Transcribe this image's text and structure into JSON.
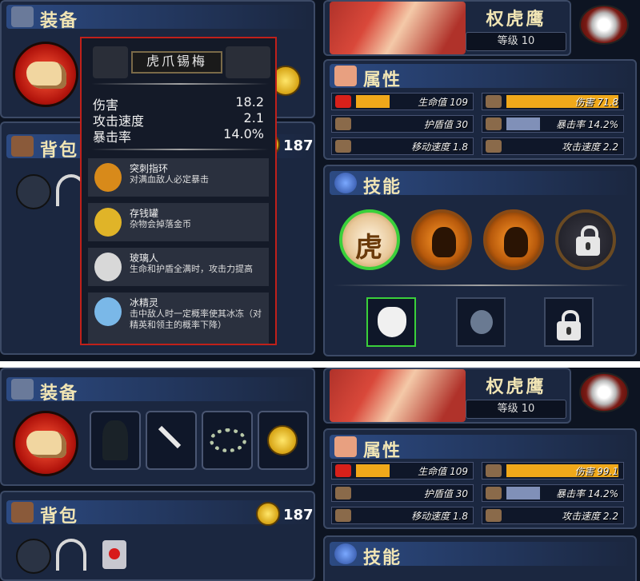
{
  "equipment": {
    "title": "装备"
  },
  "backpack": {
    "title": "背包",
    "gold": "187"
  },
  "character": {
    "name": "权虎鹰",
    "level": "等级 10"
  },
  "attributes": {
    "title": "属性",
    "stats_top": [
      {
        "label": "生命值 109",
        "fraction": 0.3,
        "color": "#f0a81a",
        "icon": "heart-icon"
      },
      {
        "label": "伤害 71.8",
        "fraction": 1.0,
        "color": "#f0a81a",
        "icon": "sword-icon"
      },
      {
        "label": "护盾值 30",
        "fraction": 0.0,
        "color": "#8090b8",
        "icon": "shield-icon"
      },
      {
        "label": "暴击率 14.2%",
        "fraction": 0.3,
        "color": "#8090b8",
        "icon": "eye-icon"
      },
      {
        "label": "移动速度 1.8",
        "fraction": 0.0,
        "color": "#8090b8",
        "icon": "boot-icon"
      },
      {
        "label": "攻击速度 2.2",
        "fraction": 0.0,
        "color": "#8090b8",
        "icon": "fist-icon"
      }
    ],
    "stats_bottom": [
      {
        "label": "生命值 109",
        "fraction": 0.3,
        "color": "#f0a81a",
        "icon": "heart-icon"
      },
      {
        "label": "伤害 99.1",
        "fraction": 1.0,
        "color": "#f0a81a",
        "icon": "sword-icon"
      },
      {
        "label": "护盾值 30",
        "fraction": 0.0,
        "color": "#8090b8",
        "icon": "shield-icon"
      },
      {
        "label": "暴击率 14.2%",
        "fraction": 0.3,
        "color": "#8090b8",
        "icon": "eye-icon"
      },
      {
        "label": "移动速度 1.8",
        "fraction": 0.0,
        "color": "#8090b8",
        "icon": "boot-icon"
      },
      {
        "label": "攻击速度 2.2",
        "fraction": 0.0,
        "color": "#8090b8",
        "icon": "fist-icon"
      }
    ]
  },
  "skills": {
    "title": "技能",
    "tiger_glyph": "虎"
  },
  "tooltip": {
    "item_name": "虎爪锡梅",
    "stats": [
      {
        "name": "伤害",
        "value": "18.2"
      },
      {
        "name": "攻击速度",
        "value": "2.1"
      },
      {
        "name": "暴击率",
        "value": "14.0%"
      }
    ],
    "perks": [
      {
        "name": "突刺指环",
        "desc": "对满血敌人必定暴击",
        "icon_color": "#d88a1a"
      },
      {
        "name": "存钱罐",
        "desc": "杂物会掉落金币",
        "icon_color": "#e0b428"
      },
      {
        "name": "玻璃人",
        "desc": "生命和护盾全满时，攻击力提高",
        "icon_color": "#d8d8d8"
      },
      {
        "name": "冰精灵",
        "desc": "击中敌人时一定概率使其冰冻（对精英和领主的概率下降）",
        "icon_color": "#7ab8e8"
      }
    ]
  }
}
